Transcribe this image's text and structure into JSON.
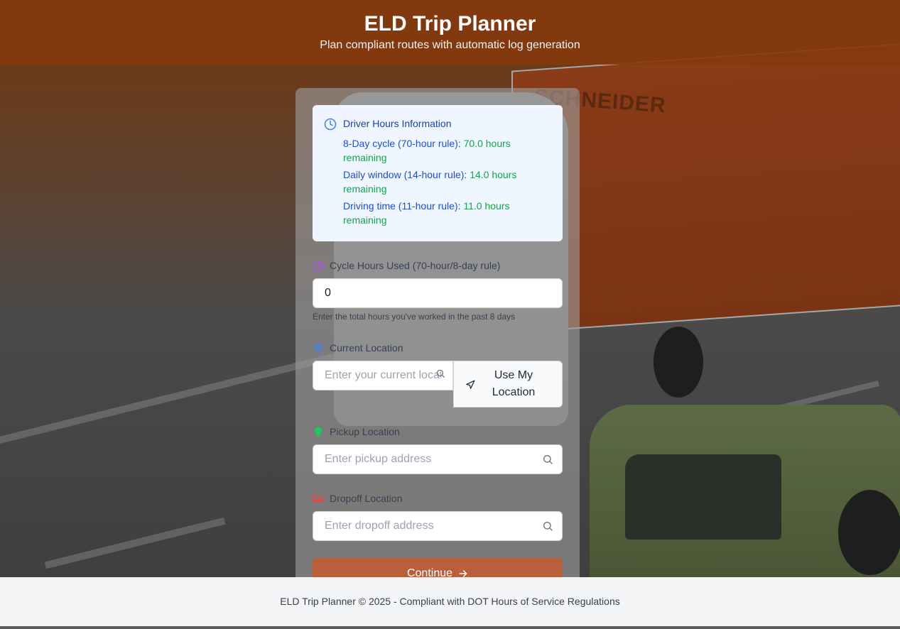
{
  "header": {
    "title": "ELD Trip Planner",
    "subtitle": "Plan compliant routes with automatic log generation"
  },
  "info": {
    "title": "Driver Hours Information",
    "icon": "clock-icon",
    "lines": [
      {
        "label": "8-Day cycle (70-hour rule):",
        "value": "70.0 hours remaining"
      },
      {
        "label": "Daily window (14-hour rule):",
        "value": "14.0 hours remaining"
      },
      {
        "label": "Driving time (11-hour rule):",
        "value": "11.0 hours remaining"
      }
    ]
  },
  "cycle": {
    "label": "Cycle Hours Used (70-hour/8-day rule)",
    "value": "0",
    "hint": "Enter the total hours you've worked in the past 8 days"
  },
  "current_location": {
    "label": "Current Location",
    "placeholder": "Enter your current location",
    "button_label": "Use My Location"
  },
  "pickup": {
    "label": "Pickup Location",
    "placeholder": "Enter pickup address"
  },
  "dropoff": {
    "label": "Dropoff Location",
    "placeholder": "Enter dropoff address"
  },
  "continue_label": "Continue",
  "footer": "ELD Trip Planner © 2025 - Compliant with DOT Hours of Service Regulations",
  "background_truck_text": "SCHNEIDER",
  "colors": {
    "header_bg": "#853a0e",
    "info_bg": "#eff6ff",
    "info_text": "#1d4ed8",
    "info_value": "#16a34a",
    "continue_bg": "#b9603b",
    "cycle_icon": "#a855f7",
    "location_icon": "#3b82f6",
    "pickup_icon": "#22c55e",
    "dropoff_icon": "#ef4444"
  }
}
